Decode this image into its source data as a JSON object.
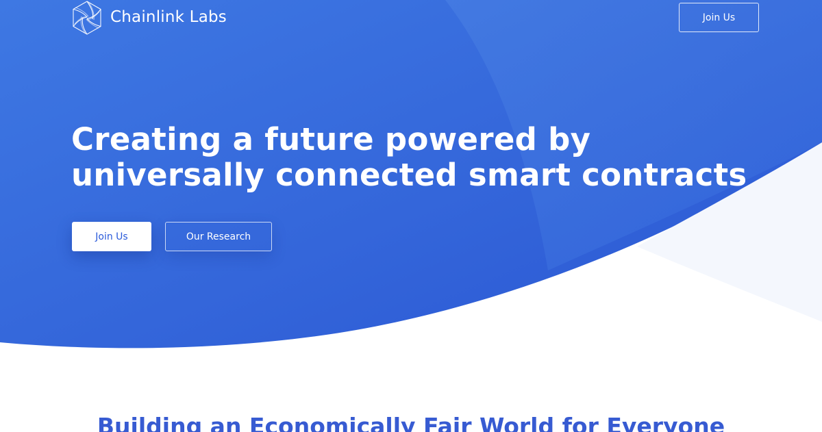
{
  "brand": {
    "name": "Chainlink Labs",
    "logo_icon": "chainlink-labs-hexagon-icon"
  },
  "nav": {
    "join_label": "Join Us"
  },
  "hero": {
    "headline_line1": "Creating a future powered by",
    "headline_line2": "universally connected smart contracts",
    "primary_button": "Join Us",
    "secondary_button": "Our Research"
  },
  "section": {
    "title": "Building an Economically Fair World for Everyone"
  },
  "colors": {
    "hero_blue_light": "#4a7fe0",
    "hero_blue_dark": "#2a56d3",
    "accent_blue": "#375bd2",
    "white": "#ffffff",
    "pale_blue": "#f4f7fd"
  }
}
